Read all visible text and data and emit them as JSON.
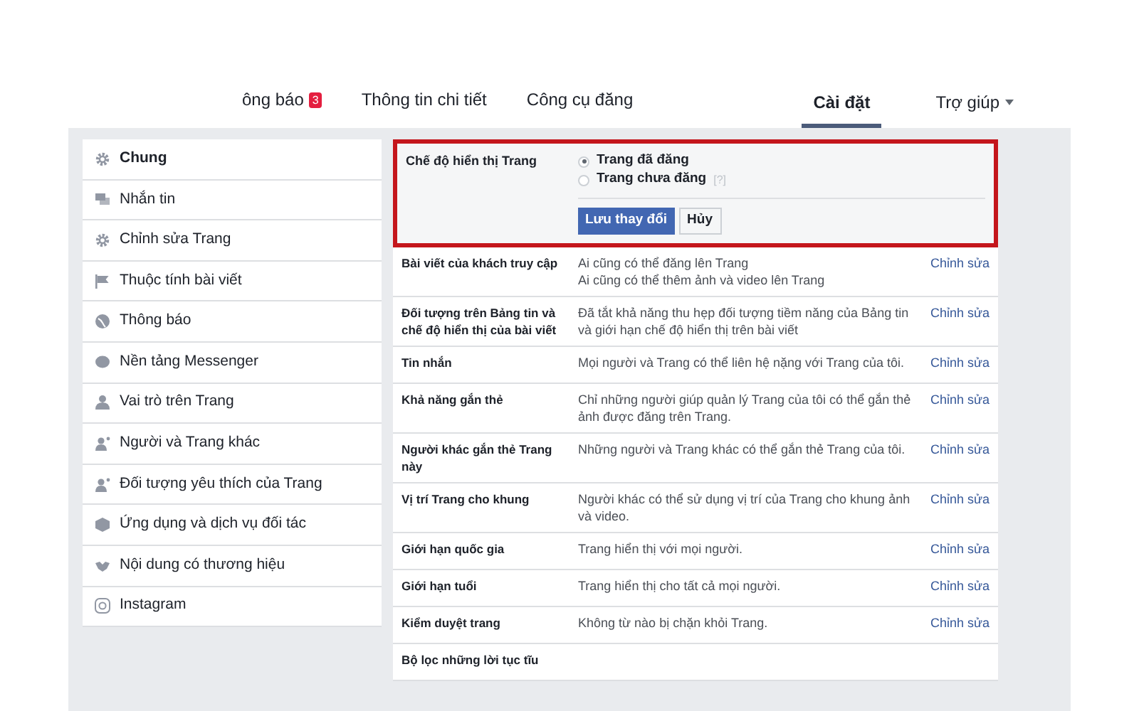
{
  "tabs": [
    {
      "label": "ông báo",
      "badge": "3",
      "selected": false
    },
    {
      "label": "Thông tin chi tiết",
      "selected": false
    },
    {
      "label": "Công cụ đăng",
      "selected": false
    }
  ],
  "right_tabs": [
    {
      "label": "Cài đặt",
      "selected": true,
      "dropdown": false
    },
    {
      "label": "Trợ giúp",
      "selected": false,
      "dropdown": true
    }
  ],
  "sidebar": {
    "items": [
      {
        "label": "Chung",
        "kind": "gear",
        "selected": true
      },
      {
        "label": "Nhắn tin",
        "kind": "chat",
        "selected": false
      },
      {
        "label": "Chỉnh sửa Trang",
        "kind": "gear",
        "selected": false
      },
      {
        "label": "Thuộc tính bài viết",
        "kind": "flag",
        "selected": false
      },
      {
        "label": "Thông báo",
        "kind": "globe",
        "selected": false
      },
      {
        "label": "Nền tảng Messenger",
        "kind": "bubble",
        "selected": false
      },
      {
        "label": "Vai trò trên Trang",
        "kind": "person",
        "selected": false
      },
      {
        "label": "Người và Trang khác",
        "kind": "people",
        "selected": false
      },
      {
        "label": "Đối tượng yêu thích của Trang",
        "kind": "people",
        "selected": false
      },
      {
        "label": "Ứng dụng và dịch vụ đối tác",
        "kind": "cube",
        "selected": false
      },
      {
        "label": "Nội dung có thương hiệu",
        "kind": "handshake",
        "selected": false
      },
      {
        "label": "Instagram",
        "kind": "instagram",
        "selected": false
      }
    ]
  },
  "visibility": {
    "label": "Chế độ hiển thị Trang",
    "options": [
      {
        "label": "Trang đã đăng",
        "selected": true
      },
      {
        "label": "Trang chưa đăng",
        "hint": "[?]",
        "selected": false
      }
    ],
    "save": "Lưu thay đổi",
    "cancel": "Hủy"
  },
  "settings": [
    {
      "label": "Bài viết của khách truy cập",
      "value": [
        "Ai cũng có thể đăng lên Trang",
        "Ai cũng có thể thêm ảnh và video lên Trang"
      ],
      "action": "Chỉnh sửa"
    },
    {
      "label": "Đối tượng trên Bảng tin và chế độ hiển thị của bài viết",
      "value": [
        "Đã tắt khả năng thu hẹp đối tượng tiềm năng của Bảng tin và giới hạn chế độ hiển thị trên bài viết"
      ],
      "action": "Chỉnh sửa"
    },
    {
      "label": "Tin nhắn",
      "value": [
        "Mọi người và Trang có thể liên hệ nặng với Trang của tôi."
      ],
      "action": "Chỉnh sửa"
    },
    {
      "label": "Khả năng gắn thẻ",
      "value": [
        "Chỉ những người giúp quản lý Trang của tôi có thể gắn thẻ ảnh được đăng trên Trang."
      ],
      "action": "Chỉnh sửa"
    },
    {
      "label": "Người khác gắn thẻ Trang này",
      "value": [
        "Những người và Trang khác có thể gắn thẻ Trang của tôi."
      ],
      "action": "Chỉnh sửa"
    },
    {
      "label": "Vị trí Trang cho khung",
      "value": [
        "Người khác có thể sử dụng vị trí của Trang cho khung ảnh và video."
      ],
      "action": "Chỉnh sửa"
    },
    {
      "label": "Giới hạn quốc gia",
      "value": [
        "Trang hiển thị với mọi người."
      ],
      "action": "Chỉnh sửa"
    },
    {
      "label": "Giới hạn tuổi",
      "value": [
        "Trang hiển thị cho tất cả mọi người."
      ],
      "action": "Chỉnh sửa"
    },
    {
      "label": "Kiểm duyệt trang",
      "value": [
        "Không từ nào bị chặn khỏi Trang."
      ],
      "action": "Chỉnh sửa"
    },
    {
      "label": "Bộ lọc những lời tục tĩu"
    }
  ]
}
